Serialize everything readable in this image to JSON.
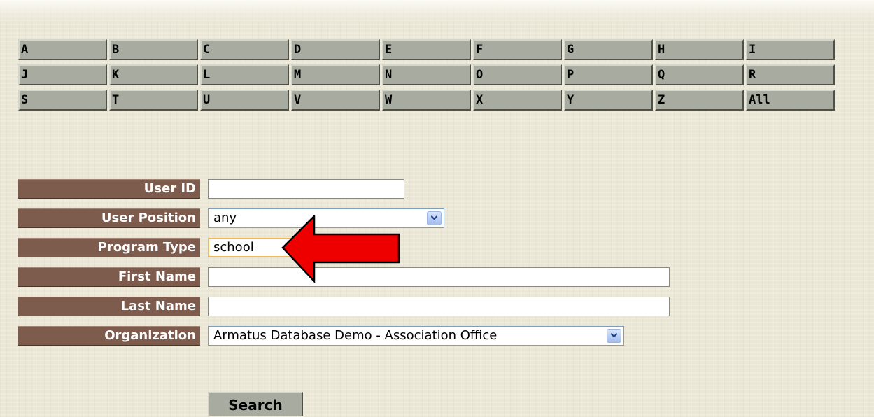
{
  "letter_buttons": [
    "A",
    "B",
    "C",
    "D",
    "E",
    "F",
    "G",
    "H",
    "I",
    "J",
    "K",
    "L",
    "M",
    "N",
    "O",
    "P",
    "Q",
    "R",
    "S",
    "T",
    "U",
    "V",
    "W",
    "X",
    "Y",
    "Z",
    "All"
  ],
  "form": {
    "user_id": {
      "label": "User ID",
      "value": ""
    },
    "user_position": {
      "label": "User Position",
      "value": "any"
    },
    "program_type": {
      "label": "Program Type",
      "value": "school"
    },
    "first_name": {
      "label": "First Name",
      "value": ""
    },
    "last_name": {
      "label": "Last Name",
      "value": ""
    },
    "organization": {
      "label": "Organization",
      "value": "Armatus Database Demo - Association Office"
    }
  },
  "search_label": "Search",
  "annotation": {
    "icon": "red-arrow-icon",
    "color": "#ee0000"
  },
  "colors": {
    "label_bg": "#7d5b4d",
    "letter_btn_bg": "#a8ab9f",
    "focus_border": "#f1b75c"
  }
}
